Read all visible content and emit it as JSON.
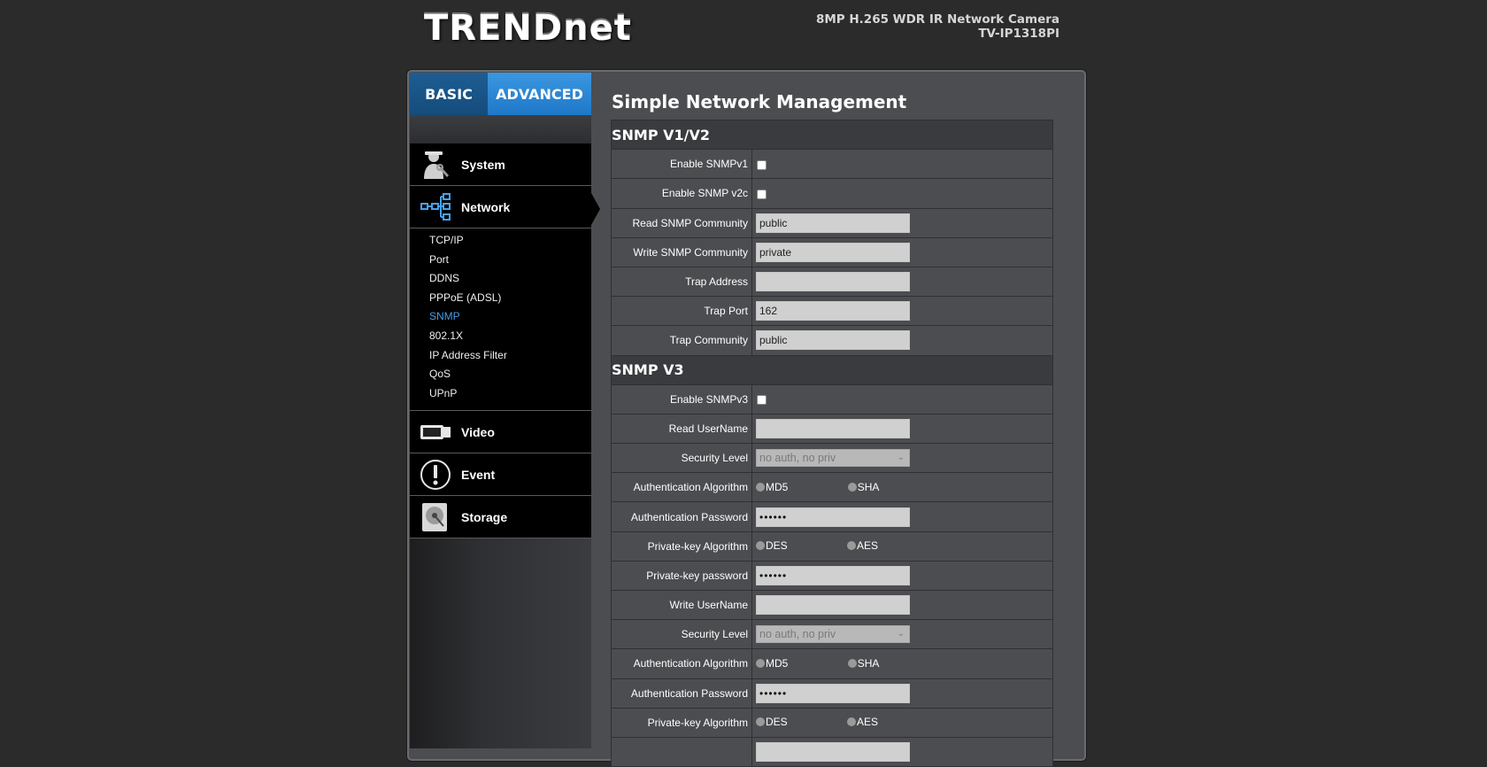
{
  "header": {
    "logo_trend": "TREND",
    "logo_net": "net",
    "model_line1": "8MP H.265 WDR IR Network Camera",
    "model_line2": "TV-IP1318PI"
  },
  "tabs": {
    "basic": "BASIC",
    "advanced": "ADVANCED"
  },
  "sidebar": {
    "system": "System",
    "network": "Network",
    "network_items": [
      "TCP/IP",
      "Port",
      "DDNS",
      "PPPoE (ADSL)",
      "SNMP",
      "802.1X",
      "IP Address Filter",
      "QoS",
      "UPnP"
    ],
    "active_item": "SNMP",
    "video": "Video",
    "event": "Event",
    "storage": "Storage"
  },
  "page": {
    "title": "Simple Network Management"
  },
  "v1v2": {
    "header": "SNMP V1/V2",
    "enable_v1_label": "Enable SNMPv1",
    "enable_v1_checked": false,
    "enable_v2c_label": "Enable SNMP v2c",
    "enable_v2c_checked": false,
    "read_community_label": "Read SNMP Community",
    "read_community_value": "public",
    "write_community_label": "Write SNMP Community",
    "write_community_value": "private",
    "trap_address_label": "Trap Address",
    "trap_address_value": "",
    "trap_port_label": "Trap Port",
    "trap_port_value": "162",
    "trap_community_label": "Trap Community",
    "trap_community_value": "public"
  },
  "v3": {
    "header": "SNMP V3",
    "enable_v3_label": "Enable SNMPv3",
    "enable_v3_checked": false,
    "read_username_label": "Read UserName",
    "read_username_value": "",
    "security_level_label": "Security Level",
    "security_level_value": "no auth, no priv",
    "auth_algo_label": "Authentication Algorithm",
    "auth_algo_opt1": "MD5",
    "auth_algo_opt2": "SHA",
    "auth_password_label": "Authentication Password",
    "auth_password_value": "••••••",
    "priv_algo_label": "Private-key Algorithm",
    "priv_algo_opt1": "DES",
    "priv_algo_opt2": "AES",
    "priv_password_label": "Private-key password",
    "priv_password_value": "••••••",
    "write_username_label": "Write UserName",
    "write_username_value": "",
    "write_security_level_label": "Security Level",
    "write_security_level_value": "no auth, no priv",
    "write_auth_algo_label": "Authentication Algorithm",
    "write_auth_algo_opt1": "MD5",
    "write_auth_algo_opt2": "SHA",
    "write_auth_password_label": "Authentication Password",
    "write_auth_password_value": "••••••",
    "write_priv_algo_label": "Private-key Algorithm",
    "write_priv_algo_opt1": "DES",
    "write_priv_algo_opt2": "AES"
  },
  "colors": {
    "background": "#2b2b2b",
    "panel": "#4c4d50",
    "tab_basic": "#1d5d93",
    "tab_advanced": "#2b8ad8",
    "active_link": "#4a9ce8"
  },
  "icons": {
    "system": "system-admin-icon",
    "network": "network-tree-icon",
    "video": "camera-icon",
    "event": "exclamation-icon",
    "storage": "hard-disk-icon"
  }
}
